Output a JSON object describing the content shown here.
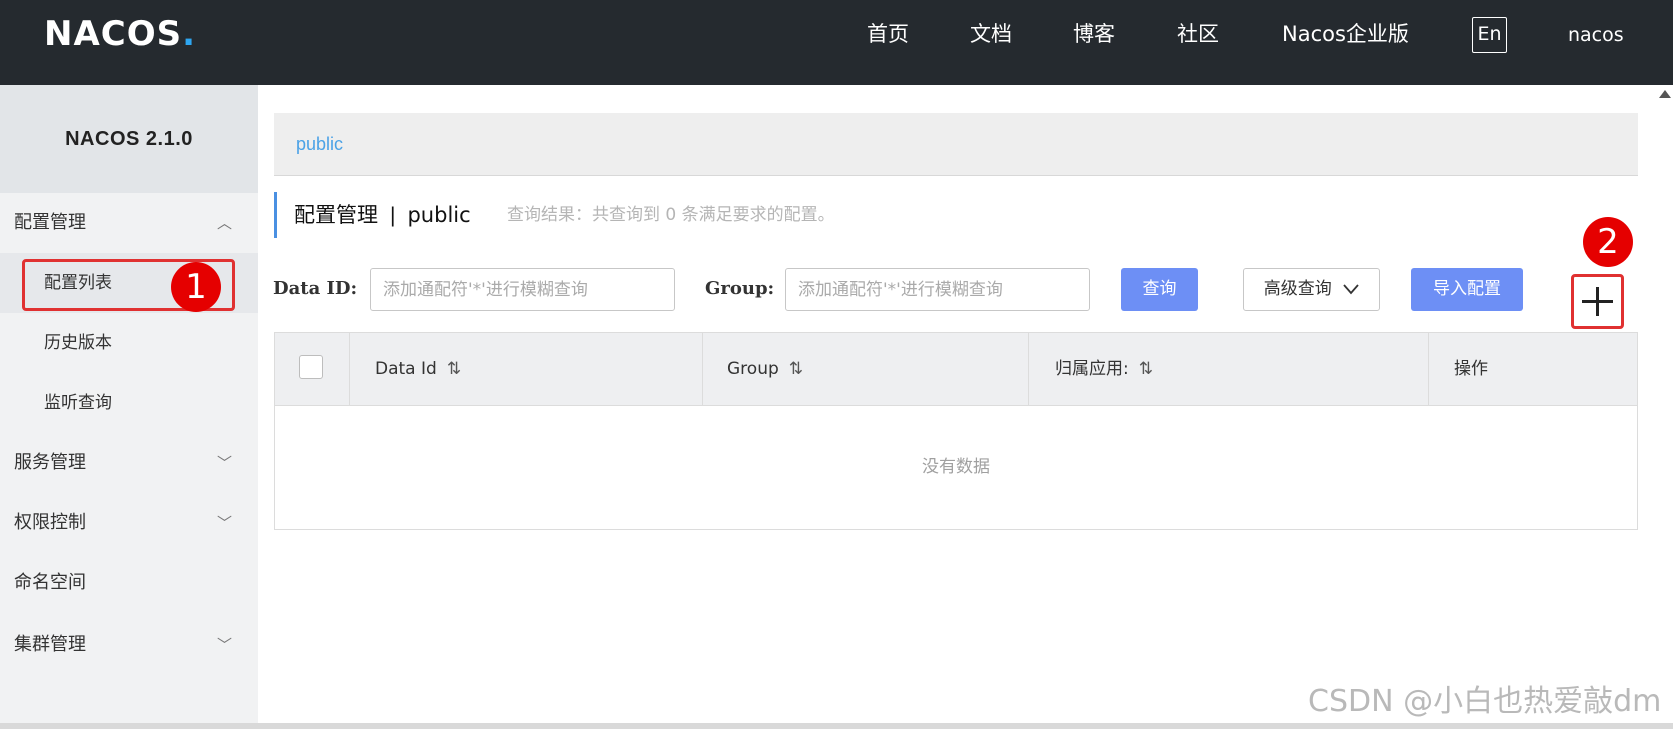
{
  "header": {
    "logo": "NACOS",
    "logo_dot": ".",
    "nav": [
      "首页",
      "文档",
      "博客",
      "社区",
      "Nacos企业版"
    ],
    "lang": "En",
    "user": "nacos"
  },
  "sidebar": {
    "version": "NACOS 2.1.0",
    "groups": {
      "config": "配置管理",
      "service": "服务管理",
      "auth": "权限控制",
      "namespace": "命名空间",
      "cluster": "集群管理"
    },
    "config_items": [
      "配置列表",
      "历史版本",
      "监听查询"
    ]
  },
  "main": {
    "namespace": "public",
    "page_title": "配置管理",
    "separator": "|",
    "page_ns": "public",
    "result_text": "查询结果：共查询到 0 条满足要求的配置。",
    "search": {
      "data_id_label": "Data ID:",
      "data_id_placeholder": "添加通配符'*'进行模糊查询",
      "group_label": "Group:",
      "group_placeholder": "添加通配符'*'进行模糊查询",
      "query_button": "查询",
      "advanced_button": "高级查询",
      "import_button": "导入配置"
    },
    "table": {
      "columns": [
        "Data Id",
        "Group",
        "归属应用:",
        "操作"
      ],
      "sort_glyph": "⇅",
      "empty_text": "没有数据"
    }
  },
  "annotations": {
    "marker_1": "1",
    "marker_2": "2"
  },
  "watermark": "CSDN @小白也热爱敲dm",
  "colors": {
    "topbar": "#252a2f",
    "primary_button": "#6d8ff5",
    "namespace_link": "#4ba2e6",
    "annotation_red": "#e03131"
  }
}
